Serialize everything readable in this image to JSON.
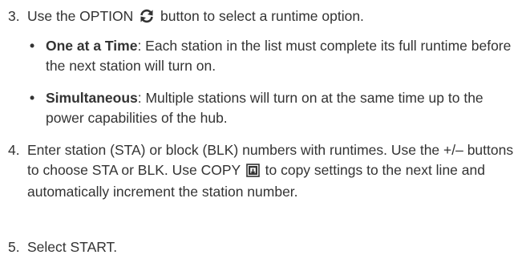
{
  "steps": [
    {
      "number": "3.",
      "text_before_icon": "Use the OPTION",
      "icon": "refresh-icon",
      "text_after_icon": "button to select a runtime option.",
      "bullets": [
        {
          "term": "One at a Time",
          "text": ": Each station in the list must complete its full runtime before the next station will turn on."
        },
        {
          "term": "Simultaneous",
          "text": ": Multiple stations will turn on at the same time up to the power capabilities of the hub."
        }
      ]
    },
    {
      "number": "4.",
      "text_before_icon": "Enter station (STA) or block (BLK) numbers with runtimes. Use the +/– buttons to choose STA or BLK. Use COPY",
      "icon": "copy-icon",
      "text_after_icon": "to copy settings to the next line and automatically increment the station number."
    },
    {
      "number": "5.",
      "text": "Select START."
    }
  ]
}
